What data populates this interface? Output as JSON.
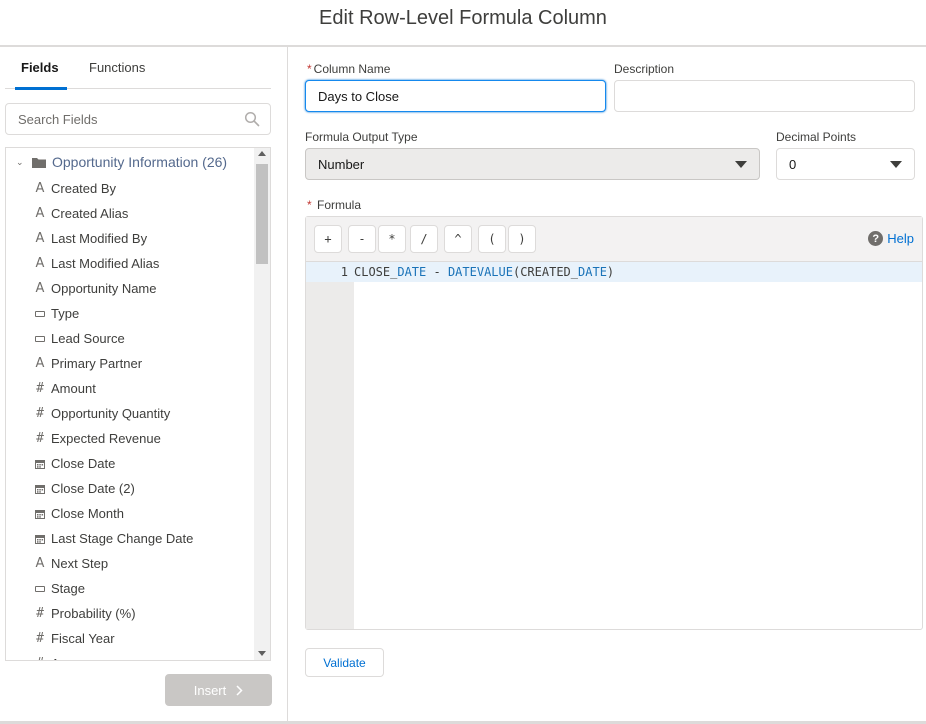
{
  "dialog": {
    "title": "Edit Row-Level Formula Column"
  },
  "left_panel": {
    "tabs": [
      {
        "label": "Fields",
        "active": true
      },
      {
        "label": "Functions",
        "active": false
      }
    ],
    "search": {
      "placeholder": "Search Fields",
      "icon": "search-icon"
    },
    "group": {
      "label": "Opportunity Information (26)",
      "expanded": true,
      "icon": "folder-icon"
    },
    "fields": [
      {
        "label": "Created By",
        "type": "text"
      },
      {
        "label": "Created Alias",
        "type": "text"
      },
      {
        "label": "Last Modified By",
        "type": "text"
      },
      {
        "label": "Last Modified Alias",
        "type": "text"
      },
      {
        "label": "Opportunity Name",
        "type": "text"
      },
      {
        "label": "Type",
        "type": "picklist"
      },
      {
        "label": "Lead Source",
        "type": "picklist"
      },
      {
        "label": "Primary Partner",
        "type": "text"
      },
      {
        "label": "Amount",
        "type": "number"
      },
      {
        "label": "Opportunity Quantity",
        "type": "number"
      },
      {
        "label": "Expected Revenue",
        "type": "number"
      },
      {
        "label": "Close Date",
        "type": "date"
      },
      {
        "label": "Close Date (2)",
        "type": "date"
      },
      {
        "label": "Close Month",
        "type": "date"
      },
      {
        "label": "Last Stage Change Date",
        "type": "date"
      },
      {
        "label": "Next Step",
        "type": "text"
      },
      {
        "label": "Stage",
        "type": "picklist"
      },
      {
        "label": "Probability (%)",
        "type": "number"
      },
      {
        "label": "Fiscal Year",
        "type": "number"
      },
      {
        "label": "A",
        "type": "number"
      }
    ],
    "insert_button": {
      "label": "Insert",
      "enabled": false
    }
  },
  "form": {
    "column_name": {
      "label": "Column Name",
      "required": true,
      "value": "Days to Close"
    },
    "description": {
      "label": "Description",
      "value": ""
    },
    "output_type": {
      "label": "Formula Output Type",
      "value": "Number"
    },
    "decimal_points": {
      "label": "Decimal Points",
      "value": "0"
    },
    "formula": {
      "label": "Formula",
      "required": true,
      "operators": [
        "+",
        "-",
        "*",
        "/",
        "^",
        "(",
        ")"
      ],
      "help_label": "Help",
      "lines": [
        {
          "number": "1",
          "text": "CLOSE_DATE - DATEVALUE(CREATED_DATE)"
        }
      ]
    },
    "validate_button": {
      "label": "Validate"
    }
  },
  "colors": {
    "brand_blue": "#0070d2",
    "border": "#dddbda",
    "required_red": "#c23934",
    "disabled_button": "#c9c7c5"
  }
}
